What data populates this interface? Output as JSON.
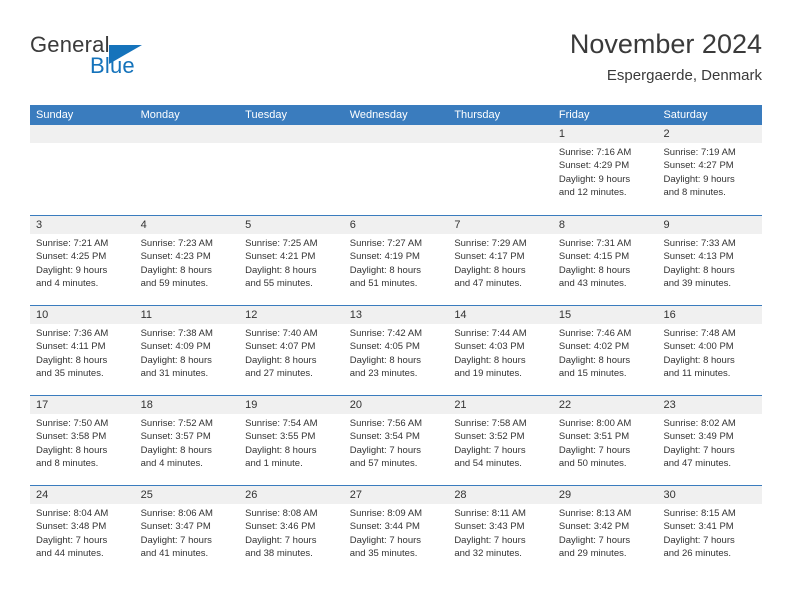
{
  "brand": {
    "word1": "General",
    "word2": "Blue",
    "flag_icon": "triangle-flag-icon",
    "accent_color": "#1573bb"
  },
  "header": {
    "month_title": "November 2024",
    "location": "Espergaerde, Denmark"
  },
  "theme": {
    "header_blue": "#3a7cbe",
    "day_band_gray": "#f0f0f0",
    "text": "#333333"
  },
  "calendar": {
    "weekdays": [
      "Sunday",
      "Monday",
      "Tuesday",
      "Wednesday",
      "Thursday",
      "Friday",
      "Saturday"
    ],
    "weeks": [
      [
        {
          "date": "",
          "sunrise": "",
          "sunset": "",
          "daylight1": "",
          "daylight2": "",
          "empty": true
        },
        {
          "date": "",
          "sunrise": "",
          "sunset": "",
          "daylight1": "",
          "daylight2": "",
          "empty": true
        },
        {
          "date": "",
          "sunrise": "",
          "sunset": "",
          "daylight1": "",
          "daylight2": "",
          "empty": true
        },
        {
          "date": "",
          "sunrise": "",
          "sunset": "",
          "daylight1": "",
          "daylight2": "",
          "empty": true
        },
        {
          "date": "",
          "sunrise": "",
          "sunset": "",
          "daylight1": "",
          "daylight2": "",
          "empty": true
        },
        {
          "date": "1",
          "sunrise": "Sunrise: 7:16 AM",
          "sunset": "Sunset: 4:29 PM",
          "daylight1": "Daylight: 9 hours",
          "daylight2": "and 12 minutes."
        },
        {
          "date": "2",
          "sunrise": "Sunrise: 7:19 AM",
          "sunset": "Sunset: 4:27 PM",
          "daylight1": "Daylight: 9 hours",
          "daylight2": "and 8 minutes."
        }
      ],
      [
        {
          "date": "3",
          "sunrise": "Sunrise: 7:21 AM",
          "sunset": "Sunset: 4:25 PM",
          "daylight1": "Daylight: 9 hours",
          "daylight2": "and 4 minutes."
        },
        {
          "date": "4",
          "sunrise": "Sunrise: 7:23 AM",
          "sunset": "Sunset: 4:23 PM",
          "daylight1": "Daylight: 8 hours",
          "daylight2": "and 59 minutes."
        },
        {
          "date": "5",
          "sunrise": "Sunrise: 7:25 AM",
          "sunset": "Sunset: 4:21 PM",
          "daylight1": "Daylight: 8 hours",
          "daylight2": "and 55 minutes."
        },
        {
          "date": "6",
          "sunrise": "Sunrise: 7:27 AM",
          "sunset": "Sunset: 4:19 PM",
          "daylight1": "Daylight: 8 hours",
          "daylight2": "and 51 minutes."
        },
        {
          "date": "7",
          "sunrise": "Sunrise: 7:29 AM",
          "sunset": "Sunset: 4:17 PM",
          "daylight1": "Daylight: 8 hours",
          "daylight2": "and 47 minutes."
        },
        {
          "date": "8",
          "sunrise": "Sunrise: 7:31 AM",
          "sunset": "Sunset: 4:15 PM",
          "daylight1": "Daylight: 8 hours",
          "daylight2": "and 43 minutes."
        },
        {
          "date": "9",
          "sunrise": "Sunrise: 7:33 AM",
          "sunset": "Sunset: 4:13 PM",
          "daylight1": "Daylight: 8 hours",
          "daylight2": "and 39 minutes."
        }
      ],
      [
        {
          "date": "10",
          "sunrise": "Sunrise: 7:36 AM",
          "sunset": "Sunset: 4:11 PM",
          "daylight1": "Daylight: 8 hours",
          "daylight2": "and 35 minutes."
        },
        {
          "date": "11",
          "sunrise": "Sunrise: 7:38 AM",
          "sunset": "Sunset: 4:09 PM",
          "daylight1": "Daylight: 8 hours",
          "daylight2": "and 31 minutes."
        },
        {
          "date": "12",
          "sunrise": "Sunrise: 7:40 AM",
          "sunset": "Sunset: 4:07 PM",
          "daylight1": "Daylight: 8 hours",
          "daylight2": "and 27 minutes."
        },
        {
          "date": "13",
          "sunrise": "Sunrise: 7:42 AM",
          "sunset": "Sunset: 4:05 PM",
          "daylight1": "Daylight: 8 hours",
          "daylight2": "and 23 minutes."
        },
        {
          "date": "14",
          "sunrise": "Sunrise: 7:44 AM",
          "sunset": "Sunset: 4:03 PM",
          "daylight1": "Daylight: 8 hours",
          "daylight2": "and 19 minutes."
        },
        {
          "date": "15",
          "sunrise": "Sunrise: 7:46 AM",
          "sunset": "Sunset: 4:02 PM",
          "daylight1": "Daylight: 8 hours",
          "daylight2": "and 15 minutes."
        },
        {
          "date": "16",
          "sunrise": "Sunrise: 7:48 AM",
          "sunset": "Sunset: 4:00 PM",
          "daylight1": "Daylight: 8 hours",
          "daylight2": "and 11 minutes."
        }
      ],
      [
        {
          "date": "17",
          "sunrise": "Sunrise: 7:50 AM",
          "sunset": "Sunset: 3:58 PM",
          "daylight1": "Daylight: 8 hours",
          "daylight2": "and 8 minutes."
        },
        {
          "date": "18",
          "sunrise": "Sunrise: 7:52 AM",
          "sunset": "Sunset: 3:57 PM",
          "daylight1": "Daylight: 8 hours",
          "daylight2": "and 4 minutes."
        },
        {
          "date": "19",
          "sunrise": "Sunrise: 7:54 AM",
          "sunset": "Sunset: 3:55 PM",
          "daylight1": "Daylight: 8 hours",
          "daylight2": "and 1 minute."
        },
        {
          "date": "20",
          "sunrise": "Sunrise: 7:56 AM",
          "sunset": "Sunset: 3:54 PM",
          "daylight1": "Daylight: 7 hours",
          "daylight2": "and 57 minutes."
        },
        {
          "date": "21",
          "sunrise": "Sunrise: 7:58 AM",
          "sunset": "Sunset: 3:52 PM",
          "daylight1": "Daylight: 7 hours",
          "daylight2": "and 54 minutes."
        },
        {
          "date": "22",
          "sunrise": "Sunrise: 8:00 AM",
          "sunset": "Sunset: 3:51 PM",
          "daylight1": "Daylight: 7 hours",
          "daylight2": "and 50 minutes."
        },
        {
          "date": "23",
          "sunrise": "Sunrise: 8:02 AM",
          "sunset": "Sunset: 3:49 PM",
          "daylight1": "Daylight: 7 hours",
          "daylight2": "and 47 minutes."
        }
      ],
      [
        {
          "date": "24",
          "sunrise": "Sunrise: 8:04 AM",
          "sunset": "Sunset: 3:48 PM",
          "daylight1": "Daylight: 7 hours",
          "daylight2": "and 44 minutes."
        },
        {
          "date": "25",
          "sunrise": "Sunrise: 8:06 AM",
          "sunset": "Sunset: 3:47 PM",
          "daylight1": "Daylight: 7 hours",
          "daylight2": "and 41 minutes."
        },
        {
          "date": "26",
          "sunrise": "Sunrise: 8:08 AM",
          "sunset": "Sunset: 3:46 PM",
          "daylight1": "Daylight: 7 hours",
          "daylight2": "and 38 minutes."
        },
        {
          "date": "27",
          "sunrise": "Sunrise: 8:09 AM",
          "sunset": "Sunset: 3:44 PM",
          "daylight1": "Daylight: 7 hours",
          "daylight2": "and 35 minutes."
        },
        {
          "date": "28",
          "sunrise": "Sunrise: 8:11 AM",
          "sunset": "Sunset: 3:43 PM",
          "daylight1": "Daylight: 7 hours",
          "daylight2": "and 32 minutes."
        },
        {
          "date": "29",
          "sunrise": "Sunrise: 8:13 AM",
          "sunset": "Sunset: 3:42 PM",
          "daylight1": "Daylight: 7 hours",
          "daylight2": "and 29 minutes."
        },
        {
          "date": "30",
          "sunrise": "Sunrise: 8:15 AM",
          "sunset": "Sunset: 3:41 PM",
          "daylight1": "Daylight: 7 hours",
          "daylight2": "and 26 minutes."
        }
      ]
    ]
  }
}
